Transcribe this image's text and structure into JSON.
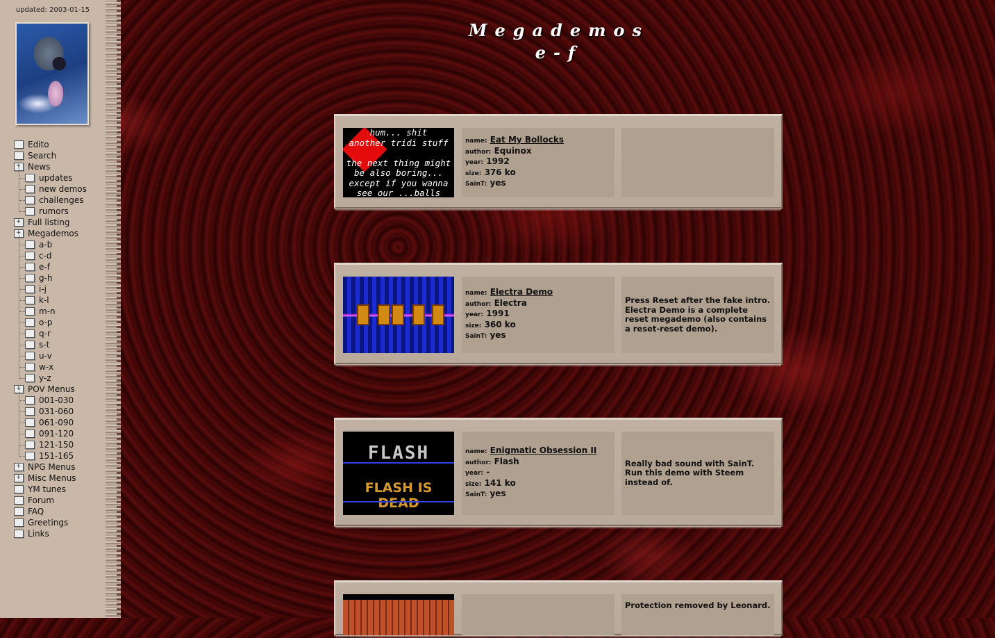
{
  "sidebar": {
    "updated": "updated: 2003-01-15",
    "nav": [
      {
        "label": "Edito",
        "level": 0,
        "plus": false
      },
      {
        "label": "Search",
        "level": 0,
        "plus": false
      },
      {
        "label": "News",
        "level": 0,
        "plus": true
      },
      {
        "label": "updates",
        "level": 1,
        "plus": false
      },
      {
        "label": "new demos",
        "level": 1,
        "plus": false
      },
      {
        "label": "challenges",
        "level": 1,
        "plus": false
      },
      {
        "label": "rumors",
        "level": 1,
        "plus": false
      },
      {
        "label": "Full listing",
        "level": 0,
        "plus": true
      },
      {
        "label": "Megademos",
        "level": 0,
        "plus": true
      },
      {
        "label": "a-b",
        "level": 1,
        "plus": false
      },
      {
        "label": "c-d",
        "level": 1,
        "plus": false
      },
      {
        "label": "e-f",
        "level": 1,
        "plus": false
      },
      {
        "label": "g-h",
        "level": 1,
        "plus": false
      },
      {
        "label": "i-j",
        "level": 1,
        "plus": false
      },
      {
        "label": "k-l",
        "level": 1,
        "plus": false
      },
      {
        "label": "m-n",
        "level": 1,
        "plus": false
      },
      {
        "label": "o-p",
        "level": 1,
        "plus": false
      },
      {
        "label": "q-r",
        "level": 1,
        "plus": false
      },
      {
        "label": "s-t",
        "level": 1,
        "plus": false
      },
      {
        "label": "u-v",
        "level": 1,
        "plus": false
      },
      {
        "label": "w-x",
        "level": 1,
        "plus": false
      },
      {
        "label": "y-z",
        "level": 1,
        "plus": false
      },
      {
        "label": "POV Menus",
        "level": 0,
        "plus": true
      },
      {
        "label": "001-030",
        "level": 1,
        "plus": false
      },
      {
        "label": "031-060",
        "level": 1,
        "plus": false
      },
      {
        "label": "061-090",
        "level": 1,
        "plus": false
      },
      {
        "label": "091-120",
        "level": 1,
        "plus": false
      },
      {
        "label": "121-150",
        "level": 1,
        "plus": false
      },
      {
        "label": "151-165",
        "level": 1,
        "plus": false
      },
      {
        "label": "NPG Menus",
        "level": 0,
        "plus": true
      },
      {
        "label": "Misc Menus",
        "level": 0,
        "plus": true
      },
      {
        "label": "YM tunes",
        "level": 0,
        "plus": false
      },
      {
        "label": "Forum",
        "level": 0,
        "plus": false
      },
      {
        "label": "FAQ",
        "level": 0,
        "plus": false
      },
      {
        "label": "Greetings",
        "level": 0,
        "plus": false
      },
      {
        "label": "Links",
        "level": 0,
        "plus": false
      }
    ]
  },
  "header": {
    "title": "Megademos",
    "subtitle": "e-f"
  },
  "labels": {
    "name": "name:",
    "author": "author:",
    "year": "year:",
    "size": "size:",
    "saint": "SainT:"
  },
  "demos": [
    {
      "name": "Eat My Bollocks",
      "author": "Equinox",
      "year": "1992",
      "size": "376 ko",
      "saint": "yes",
      "notes": "",
      "thumb_text": [
        "hum...  shit",
        "another tridi stuff",
        "",
        "the next thing might",
        "be also boring...",
        "except if you wanna",
        "see our   ...balls"
      ]
    },
    {
      "name": "Electra Demo",
      "author": "Electra",
      "year": "1991",
      "size": "360 ko",
      "saint": "yes",
      "notes": "Press Reset after the fake intro. Electra Demo is a complete reset megademo (also contains a reset-reset demo)."
    },
    {
      "name": "Enigmatic Obsession II",
      "author": "Flash",
      "year": "-",
      "size": "141 ko",
      "saint": "yes",
      "notes": "Really bad sound with SainT. Run this demo with Steem instead of.",
      "thumb_text": [
        "FLASH",
        "FLASH IS DEAD"
      ]
    },
    {
      "name": "",
      "author": "",
      "year": "",
      "size": "",
      "saint": "",
      "notes": "Protection removed by Leonard."
    }
  ]
}
